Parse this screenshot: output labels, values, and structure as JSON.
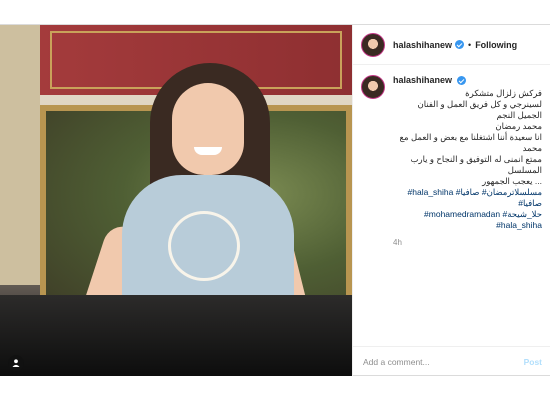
{
  "post": {
    "username": "halashihanew",
    "follow_status": "Following",
    "separator": "•",
    "caption_username": "halashihanew",
    "caption_lines": [
      "فركش زلزال متشكرة",
      "لسينرجي و كل فريق العمل و الفنان الجميل النجم",
      "محمد رمضان",
      "انا سعيدة أننا اشتغلنا مع بعض و العمل مع محمد",
      "ممتع انمنى له التوفيق و النجاح و يارب المسلسل",
      "... يعجب الجمهور"
    ],
    "hashtag_lines": [
      "مسلسلاترمضان# صافيا# hala_shiha# صافيا#",
      "حلا_شيحة# mohamedramadan#",
      "hala_shiha#"
    ],
    "time_ago": "4h",
    "comment_placeholder": "Add a comment...",
    "post_button": "Post"
  },
  "icons": {
    "verified": "verified-badge-icon",
    "tag": "person-tag-icon"
  },
  "colors": {
    "verified": "#3897f0",
    "hashtag": "#003569",
    "post_disabled": "#b2dffc"
  }
}
